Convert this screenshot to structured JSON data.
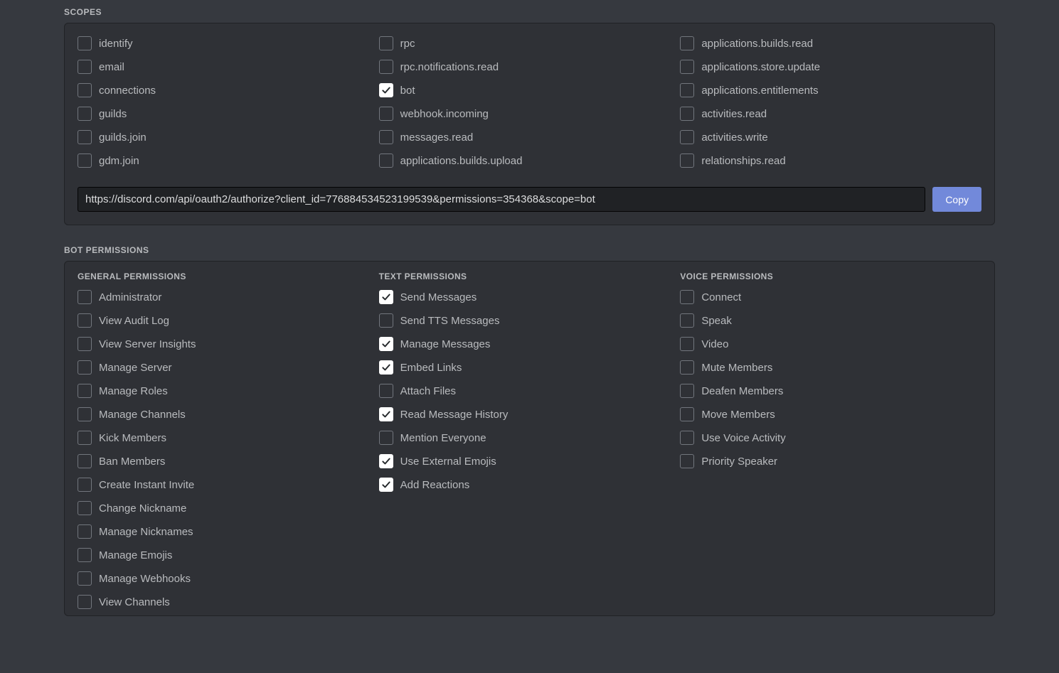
{
  "scopes": {
    "title": "SCOPES",
    "columns": [
      [
        {
          "id": "identify",
          "label": "identify",
          "checked": false
        },
        {
          "id": "email",
          "label": "email",
          "checked": false
        },
        {
          "id": "connections",
          "label": "connections",
          "checked": false
        },
        {
          "id": "guilds",
          "label": "guilds",
          "checked": false
        },
        {
          "id": "guilds-join",
          "label": "guilds.join",
          "checked": false
        },
        {
          "id": "gdm-join",
          "label": "gdm.join",
          "checked": false
        }
      ],
      [
        {
          "id": "rpc",
          "label": "rpc",
          "checked": false
        },
        {
          "id": "rpc-notifications-read",
          "label": "rpc.notifications.read",
          "checked": false
        },
        {
          "id": "bot",
          "label": "bot",
          "checked": true
        },
        {
          "id": "webhook-incoming",
          "label": "webhook.incoming",
          "checked": false
        },
        {
          "id": "messages-read",
          "label": "messages.read",
          "checked": false
        },
        {
          "id": "applications-builds-upload",
          "label": "applications.builds.upload",
          "checked": false
        }
      ],
      [
        {
          "id": "applications-builds-read",
          "label": "applications.builds.read",
          "checked": false
        },
        {
          "id": "applications-store-update",
          "label": "applications.store.update",
          "checked": false
        },
        {
          "id": "applications-entitlements",
          "label": "applications.entitlements",
          "checked": false
        },
        {
          "id": "activities-read",
          "label": "activities.read",
          "checked": false
        },
        {
          "id": "activities-write",
          "label": "activities.write",
          "checked": false
        },
        {
          "id": "relationships-read",
          "label": "relationships.read",
          "checked": false
        }
      ]
    ],
    "url_value": "https://discord.com/api/oauth2/authorize?client_id=776884534523199539&permissions=354368&scope=bot",
    "copy_label": "Copy"
  },
  "bot_permissions": {
    "title": "BOT PERMISSIONS",
    "groups": [
      {
        "title": "GENERAL PERMISSIONS",
        "items": [
          {
            "id": "administrator",
            "label": "Administrator",
            "checked": false
          },
          {
            "id": "view-audit-log",
            "label": "View Audit Log",
            "checked": false
          },
          {
            "id": "view-server-insights",
            "label": "View Server Insights",
            "checked": false
          },
          {
            "id": "manage-server",
            "label": "Manage Server",
            "checked": false
          },
          {
            "id": "manage-roles",
            "label": "Manage Roles",
            "checked": false
          },
          {
            "id": "manage-channels",
            "label": "Manage Channels",
            "checked": false
          },
          {
            "id": "kick-members",
            "label": "Kick Members",
            "checked": false
          },
          {
            "id": "ban-members",
            "label": "Ban Members",
            "checked": false
          },
          {
            "id": "create-instant-invite",
            "label": "Create Instant Invite",
            "checked": false
          },
          {
            "id": "change-nickname",
            "label": "Change Nickname",
            "checked": false
          },
          {
            "id": "manage-nicknames",
            "label": "Manage Nicknames",
            "checked": false
          },
          {
            "id": "manage-emojis",
            "label": "Manage Emojis",
            "checked": false
          },
          {
            "id": "manage-webhooks",
            "label": "Manage Webhooks",
            "checked": false
          },
          {
            "id": "view-channels",
            "label": "View Channels",
            "checked": false
          }
        ]
      },
      {
        "title": "TEXT PERMISSIONS",
        "items": [
          {
            "id": "send-messages",
            "label": "Send Messages",
            "checked": true
          },
          {
            "id": "send-tts-messages",
            "label": "Send TTS Messages",
            "checked": false
          },
          {
            "id": "manage-messages",
            "label": "Manage Messages",
            "checked": true
          },
          {
            "id": "embed-links",
            "label": "Embed Links",
            "checked": true
          },
          {
            "id": "attach-files",
            "label": "Attach Files",
            "checked": false
          },
          {
            "id": "read-message-history",
            "label": "Read Message History",
            "checked": true
          },
          {
            "id": "mention-everyone",
            "label": "Mention Everyone",
            "checked": false
          },
          {
            "id": "use-external-emojis",
            "label": "Use External Emojis",
            "checked": true
          },
          {
            "id": "add-reactions",
            "label": "Add Reactions",
            "checked": true
          }
        ]
      },
      {
        "title": "VOICE PERMISSIONS",
        "items": [
          {
            "id": "connect",
            "label": "Connect",
            "checked": false
          },
          {
            "id": "speak",
            "label": "Speak",
            "checked": false
          },
          {
            "id": "video",
            "label": "Video",
            "checked": false
          },
          {
            "id": "mute-members",
            "label": "Mute Members",
            "checked": false
          },
          {
            "id": "deafen-members",
            "label": "Deafen Members",
            "checked": false
          },
          {
            "id": "move-members",
            "label": "Move Members",
            "checked": false
          },
          {
            "id": "use-voice-activity",
            "label": "Use Voice Activity",
            "checked": false
          },
          {
            "id": "priority-speaker",
            "label": "Priority Speaker",
            "checked": false
          }
        ]
      }
    ]
  }
}
